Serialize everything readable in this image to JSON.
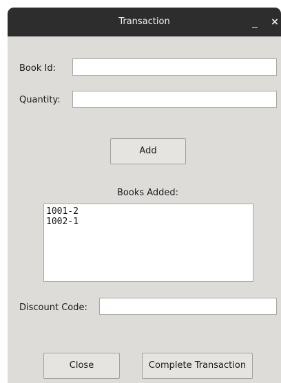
{
  "window": {
    "title": "Transaction",
    "minimize_glyph": "_",
    "close_glyph": "×"
  },
  "form": {
    "book_id_label": "Book Id:",
    "book_id_value": "",
    "quantity_label": "Quantity:",
    "quantity_value": "",
    "add_button": "Add",
    "books_added_label": "Books Added:",
    "books_added_items": [
      "1001-2",
      "1002-1"
    ],
    "discount_label": "Discount Code:",
    "discount_value": ""
  },
  "footer": {
    "close_button": "Close",
    "complete_button": "Complete Transaction"
  },
  "icons": {
    "minimize": "minimize-icon",
    "close": "close-icon"
  }
}
